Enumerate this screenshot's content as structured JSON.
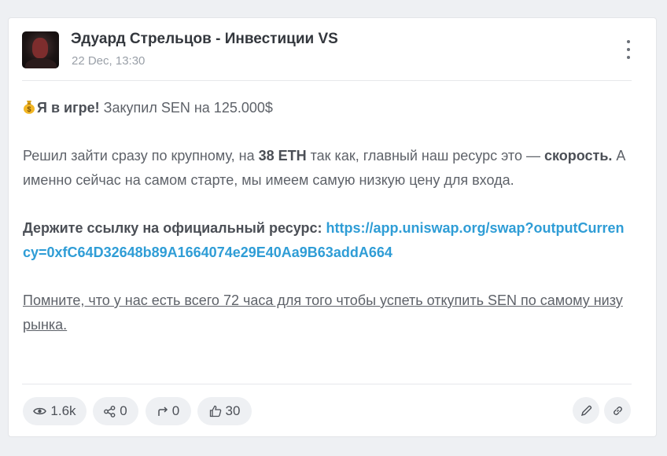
{
  "post": {
    "author": "Эдуард Стрельцов - Инвестиции VS",
    "date": "22 Dec, 13:30",
    "line1_bold": "Я в игре!",
    "line1_rest": " Закупил SEN на 125.000$",
    "p2_a": "Решил зайти сразу по крупному, на ",
    "p2_bold1": "38 ETH",
    "p2_b": " так как, главный наш ресурс это — ",
    "p2_bold2": "скорость.",
    "p2_c": " А именно сейчас на самом старте, мы имеем самую низкую цену для входа.",
    "p3_bold": "Держите ссылку на официальный ресурс:",
    "p3_link": "https://app.uniswap.org/swap?outputCurrency=0xfC64D32648b89A1664074e29E40Aa9B63addA664",
    "p4_underlined": "Помните, что у нас есть всего 72 часа для того чтобы успеть откупить SEN по самому низу рынка."
  },
  "stats": {
    "views": "1.6k",
    "shares": "0",
    "forwards": "0",
    "likes": "30"
  },
  "icons": {
    "author_avatar": "avatar",
    "menu": "kebab-menu-icon",
    "coin": "money-bag-emoji",
    "views": "eye-icon",
    "shares": "share-nodes-icon",
    "forwards": "forward-arrow-icon",
    "likes": "thumbs-up-icon",
    "edit": "pencil-icon",
    "link": "link-icon"
  },
  "colors": {
    "link": "#2f9dd6",
    "pill_bg": "#eef0f3",
    "text": "#5e6269"
  }
}
